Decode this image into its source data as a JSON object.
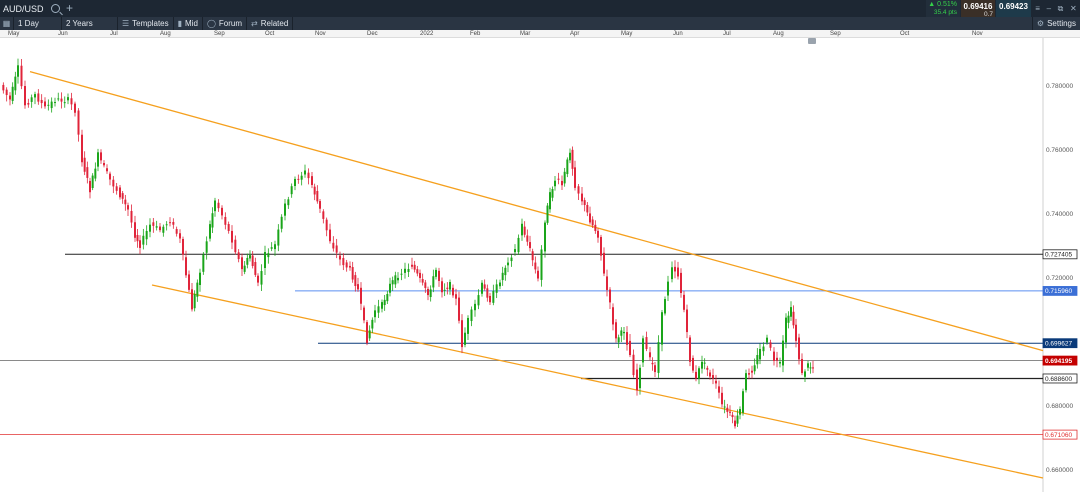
{
  "header": {
    "symbol": "AUD/USD",
    "change_pct": "▲ 0.51%",
    "change_pips": "35.4 pts",
    "sell_price": "0.69416",
    "buy_price": "0.69423",
    "spread": "0.7"
  },
  "toolbar": {
    "period": "1 Day",
    "range": "2 Years",
    "templates": "Templates",
    "mid": "Mid",
    "forum": "Forum",
    "related": "Related",
    "settings": "Settings"
  },
  "months": [
    "May",
    "Jun",
    "Jul",
    "Aug",
    "Sep",
    "Oct",
    "Nov",
    "Dec",
    "2022",
    "Feb",
    "Mar",
    "Apr",
    "May",
    "Jun",
    "Jul",
    "Aug",
    "Sep",
    "Oct",
    "Nov"
  ],
  "price_axis": {
    "ticks": [
      "0.780000",
      "0.760000",
      "0.740000",
      "0.720000",
      "0.700000",
      "0.680000",
      "0.660000"
    ],
    "labels": [
      {
        "text": "0.727405",
        "kind": "black"
      },
      {
        "text": "0.715960",
        "kind": "blue"
      },
      {
        "text": "0.699627",
        "kind": "navy"
      },
      {
        "text": "0.694195",
        "kind": "current"
      },
      {
        "text": "0.688600",
        "kind": "black"
      },
      {
        "text": "0.671060",
        "kind": "red"
      }
    ]
  },
  "colors": {
    "up": "#1aa51a",
    "down": "#e0243a",
    "trend": "#f5a01e",
    "support_black": "#222222",
    "level_blue": "#5b8ff0",
    "level_navy": "#0a3a7a",
    "level_red": "#e03030",
    "current": "#c40000"
  }
}
